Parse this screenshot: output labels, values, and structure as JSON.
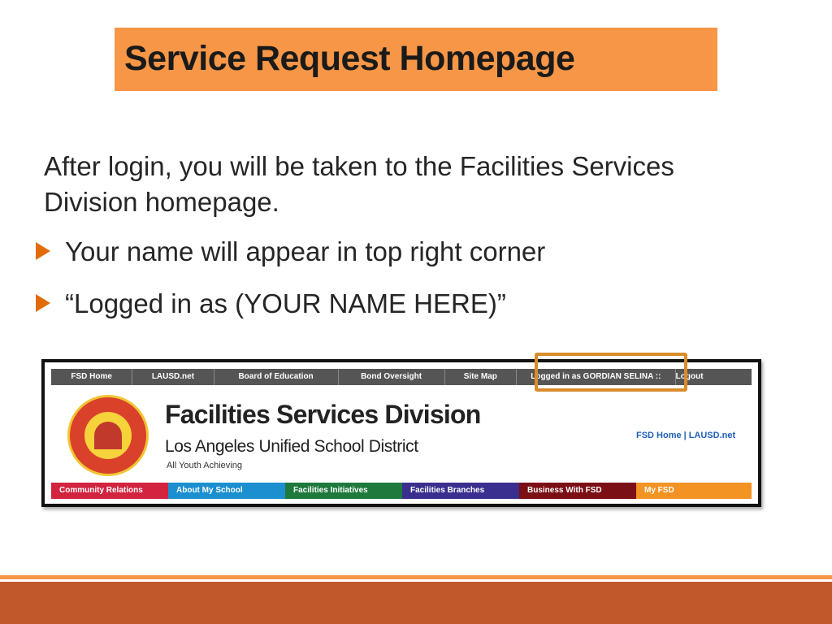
{
  "slide": {
    "title": "Service Request Homepage",
    "intro": "After login, you will be taken to the Facilities Services Division homepage.",
    "bullets": [
      "Your name will appear in top right corner",
      "“Logged in as (YOUR NAME HERE)”"
    ]
  },
  "screenshot": {
    "top_nav": [
      {
        "label": "FSD Home",
        "width": 100
      },
      {
        "label": "LAUSD.net",
        "width": 100
      },
      {
        "label": "Board of Education",
        "width": 153
      },
      {
        "label": "Bond Oversight",
        "width": 131
      },
      {
        "label": "Site Map",
        "width": 88
      },
      {
        "label": "Logged in as GORDIAN SELINA ::",
        "width": 196
      },
      {
        "label": "Logout",
        "width": 94
      }
    ],
    "fsd_title": "Facilities Services Division",
    "fsd_subtitle": "Los Angeles Unified School District",
    "fsd_tagline": "All Youth Achieving",
    "quick_links": [
      "FSD Home",
      "LAUSD.net"
    ],
    "bottom_nav": [
      {
        "label": "Community Relations",
        "color": "#d2233f"
      },
      {
        "label": "About My School",
        "color": "#1b8fcf"
      },
      {
        "label": "Facilities Initiatives",
        "color": "#1e7a3c"
      },
      {
        "label": "Facilities Branches",
        "color": "#3a2f8f"
      },
      {
        "label": "Business With FSD",
        "color": "#7a0f15"
      },
      {
        "label": "My FSD",
        "color": "#f39324"
      }
    ]
  },
  "colors": {
    "title_bg": "#f79646",
    "highlight": "#d98c2b",
    "footer": "#c0582b"
  }
}
